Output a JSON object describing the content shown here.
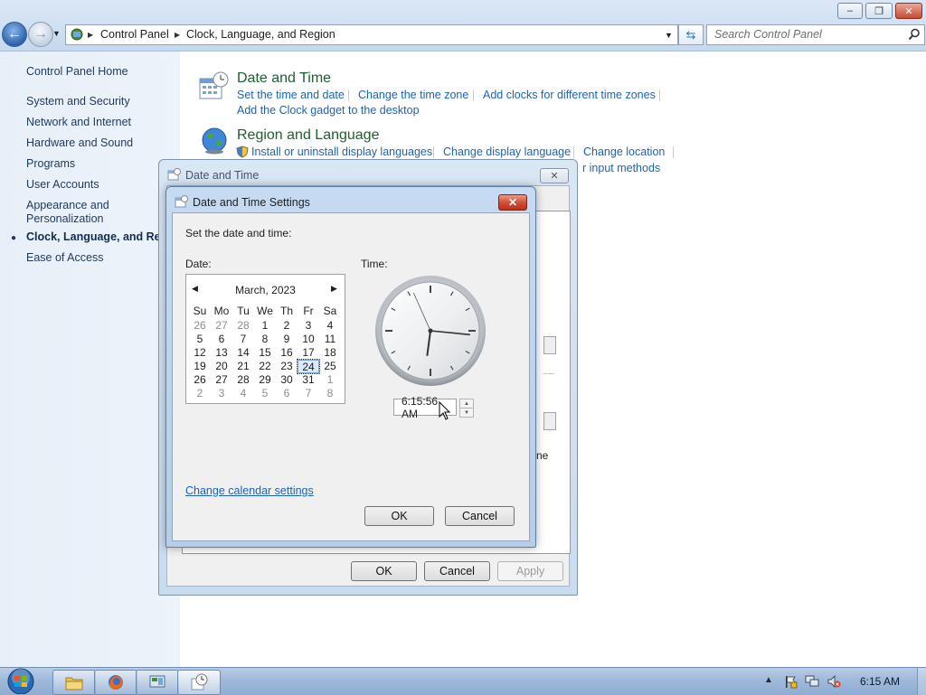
{
  "explorer": {
    "breadcrumb": [
      "Control Panel",
      "Clock, Language, and Region"
    ],
    "search_placeholder": "Search Control Panel"
  },
  "sidebar": {
    "home": "Control Panel Home",
    "items": [
      "System and Security",
      "Network and Internet",
      "Hardware and Sound",
      "Programs",
      "User Accounts",
      "Appearance and",
      "Personalization",
      "Clock, Language, and Region",
      "Ease of Access"
    ]
  },
  "content": {
    "date_time": {
      "title": "Date and Time",
      "links": [
        "Set the time and date",
        "Change the time zone",
        "Add clocks for different time zones",
        "Add the Clock gadget to the desktop"
      ]
    },
    "region_language": {
      "title": "Region and Language",
      "links": [
        "Install or uninstall display languages",
        "Change display language",
        "Change location"
      ],
      "partial_link": "r input methods"
    },
    "partial_text": "ne"
  },
  "dialog_outer": {
    "title": "Date and Time",
    "ok": "OK",
    "cancel": "Cancel",
    "apply": "Apply"
  },
  "dialog_inner": {
    "title": "Date and Time Settings",
    "instruction": "Set the date and time:",
    "date_label": "Date:",
    "time_label": "Time:",
    "month_year": "March, 2023",
    "weekdays": [
      "Su",
      "Mo",
      "Tu",
      "We",
      "Th",
      "Fr",
      "Sa"
    ],
    "weeks": [
      [
        "26",
        "27",
        "28",
        "1",
        "2",
        "3",
        "4"
      ],
      [
        "5",
        "6",
        "7",
        "8",
        "9",
        "10",
        "11"
      ],
      [
        "12",
        "13",
        "14",
        "15",
        "16",
        "17",
        "18"
      ],
      [
        "19",
        "20",
        "21",
        "22",
        "23",
        "24",
        "25"
      ],
      [
        "26",
        "27",
        "28",
        "29",
        "30",
        "31",
        "1"
      ],
      [
        "2",
        "3",
        "4",
        "5",
        "6",
        "7",
        "8"
      ]
    ],
    "selected_day": "24",
    "time_value": "6:15:56 AM",
    "clock": {
      "hour": 6,
      "minute": 15,
      "second": 56
    },
    "change_calendar_link": "Change calendar settings",
    "ok": "OK",
    "cancel": "Cancel"
  },
  "taskbar": {
    "clock": "6:15 AM"
  }
}
